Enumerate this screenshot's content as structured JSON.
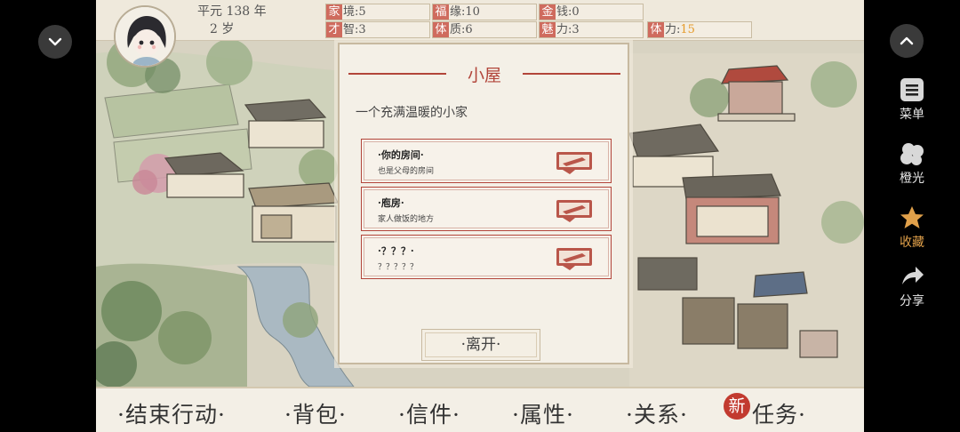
{
  "status": {
    "era_label": "平元 138 年",
    "age_label": "2   岁",
    "stats": [
      {
        "key": "家",
        "suffix": "境",
        "value": ":5"
      },
      {
        "key": "福",
        "suffix": "缘",
        "value": ":10"
      },
      {
        "key": "金",
        "suffix": "钱",
        "value": ":0"
      },
      {
        "key": "才",
        "suffix": "智",
        "value": ":3"
      },
      {
        "key": "体",
        "suffix": "质",
        "value": ":6"
      },
      {
        "key": "魅",
        "suffix": "力",
        "value": ":3"
      },
      {
        "key": "体",
        "suffix": "力",
        "value": ":",
        "highlight": "15"
      }
    ]
  },
  "dialog": {
    "title": "小屋",
    "subtitle": "一个充满温暖的小家",
    "rooms": [
      {
        "name": "·你的房间·",
        "desc": "也是父母的房间"
      },
      {
        "name": "·庖房·",
        "desc": "家人做饭的地方"
      },
      {
        "name": "·？？？·",
        "desc": "？？？？？"
      }
    ],
    "leave_label": "·离开·"
  },
  "menu": {
    "end_action": "·结束行动·",
    "bag": "·背包·",
    "letters": "·信件·",
    "attributes": "·属性·",
    "relations": "·关系·",
    "new_badge": "新",
    "tasks": "任务·"
  },
  "side": {
    "menu_label": "菜单",
    "chengguang_label": "橙光",
    "favorite_label": "收藏",
    "share_label": "分享"
  },
  "icons": {
    "collapse": "chevron-down-icon",
    "expand": "chevron-up-icon",
    "menu": "menu-icon",
    "chengguang": "clover-icon",
    "favorite": "star-icon",
    "share": "share-icon",
    "room": "bed-icon"
  },
  "colors": {
    "accent_red": "#b2453a",
    "stat_key_bg": "#cf6b5e",
    "favorite_star": "#e0a04a",
    "stamina_value": "#e69a2a"
  }
}
